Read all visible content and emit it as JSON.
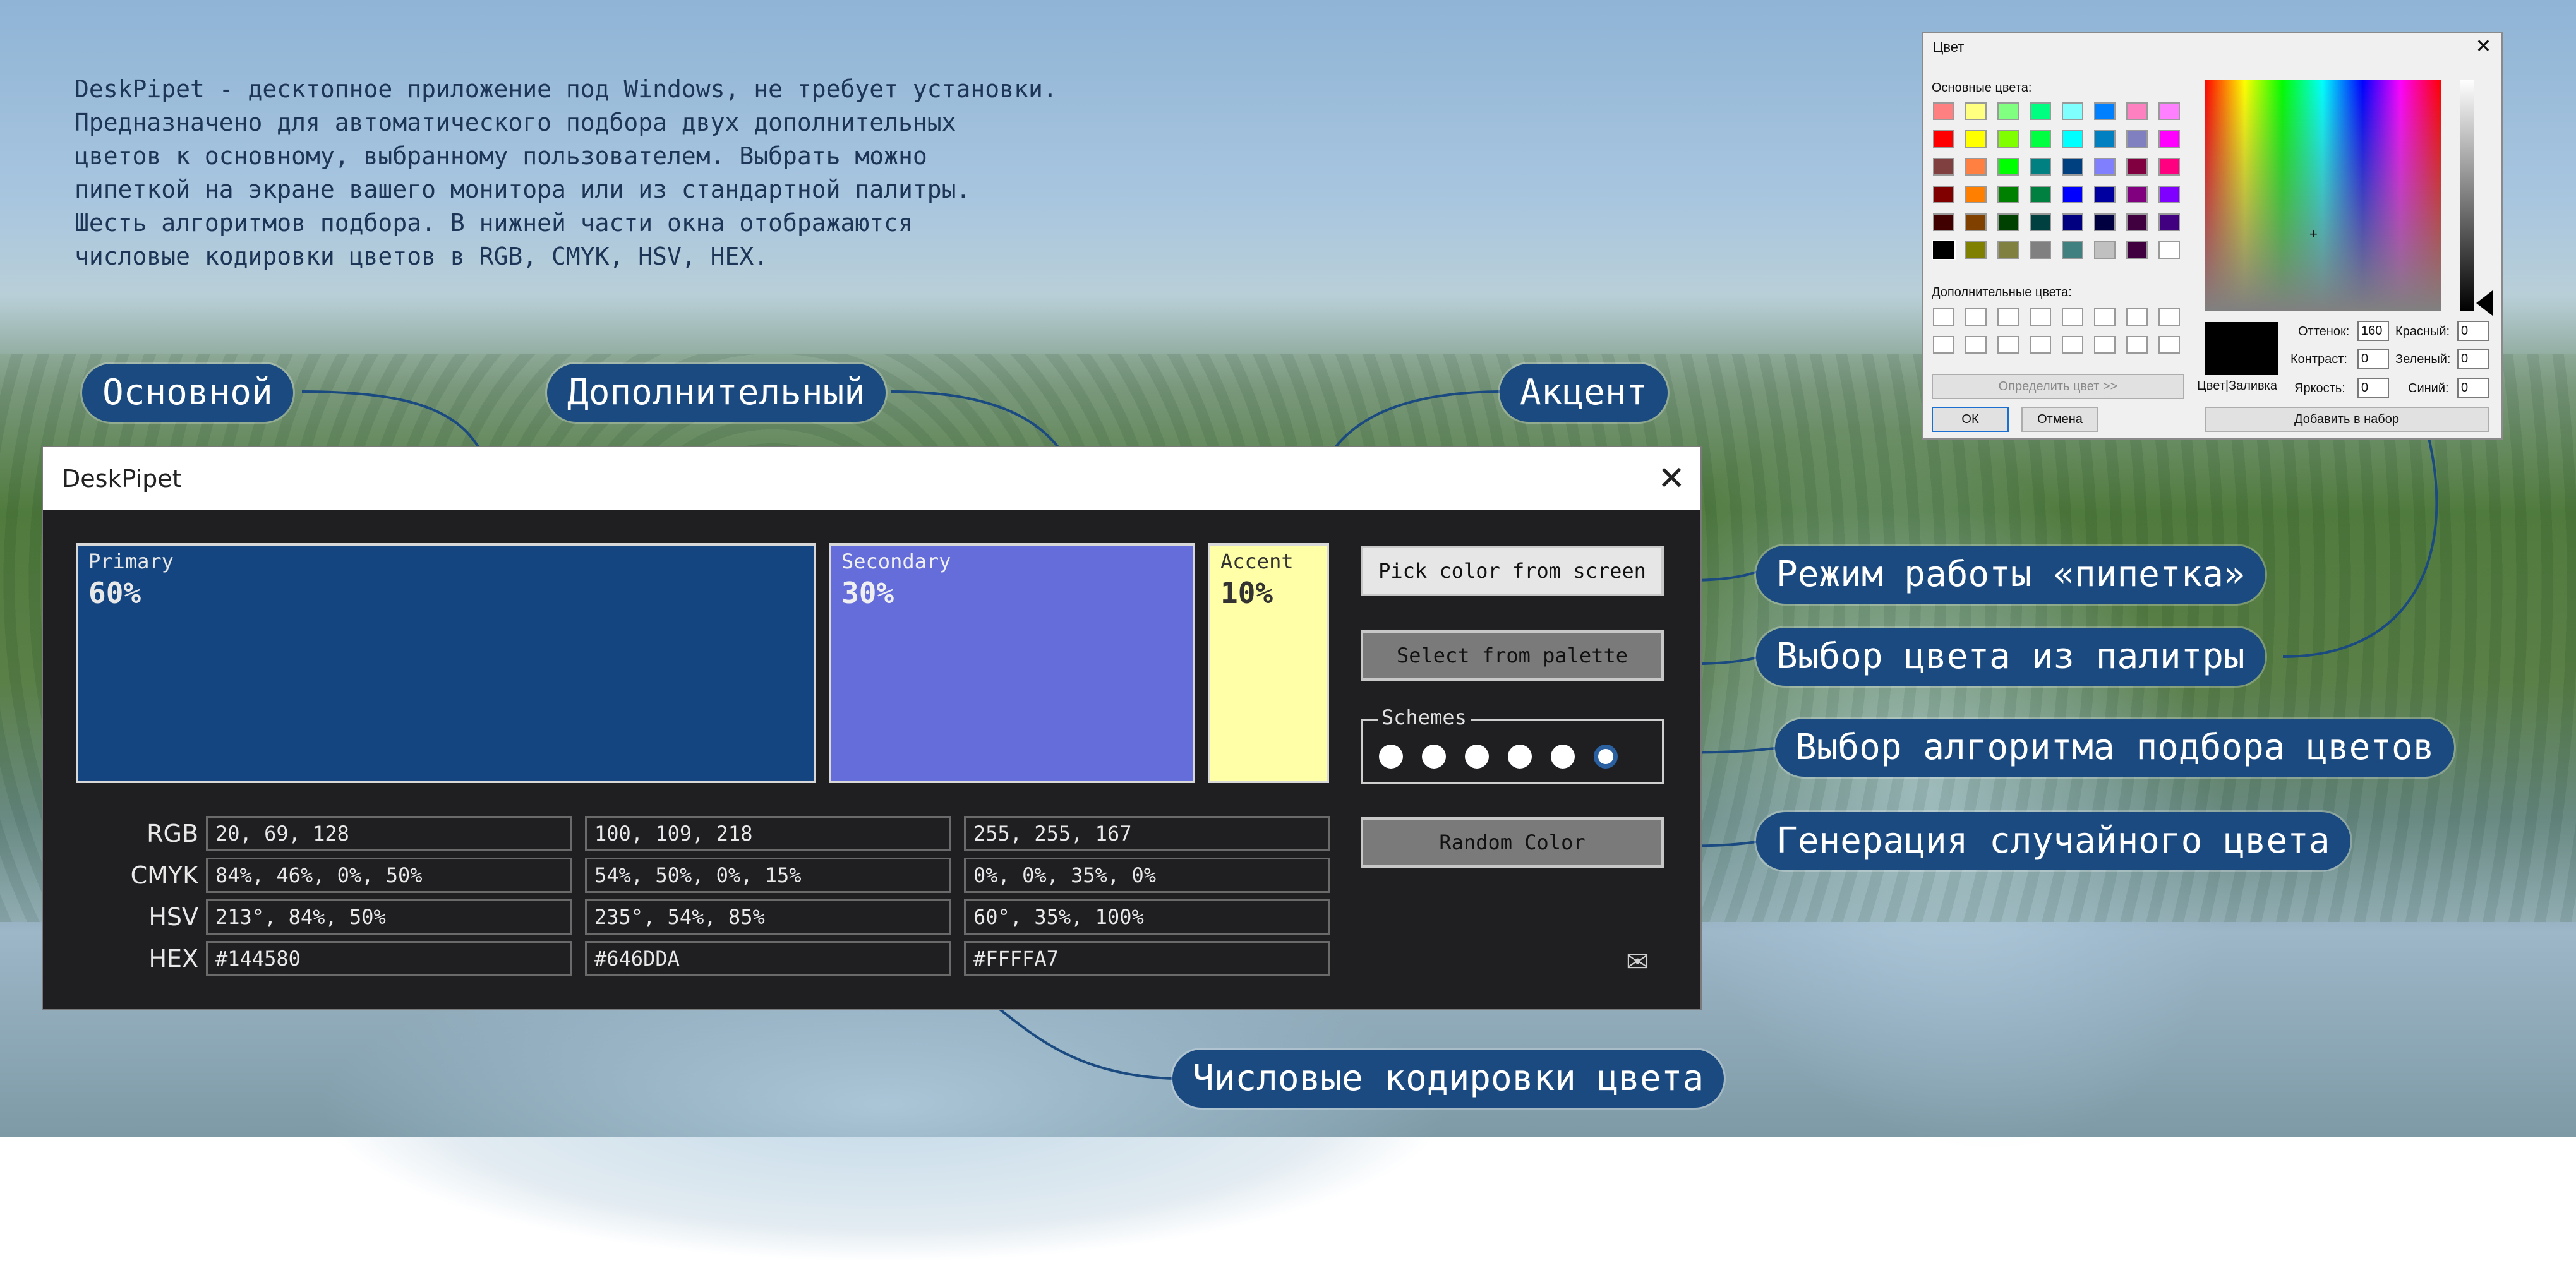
{
  "description": [
    "DeskPipet - десктопное приложение под Windows, не требует установки.",
    "Предназначено для автоматического подбора двух дополнительных",
    "цветов к основному, выбранному пользователем. Выбрать можно",
    "пипеткой на экране вашего монитора или из стандартной палитры.",
    "Шесть алгоритмов подбора. В нижней части окна отображаются",
    "числовые кодировки цветов в RGB, CMYK, HSV, HEX."
  ],
  "callouts": {
    "primary": "Основной",
    "secondary": "Дополнительный",
    "accent": "Акцент",
    "pipette": "Режим работы «пипетка»",
    "palette": "Выбор цвета из палитры",
    "algorithm": "Выбор алгоритма подбора цветов",
    "random": "Генерация случайного цвета",
    "codes": "Числовые кодировки цвета"
  },
  "window": {
    "title": "DeskPipet",
    "close": "✕",
    "swatches": {
      "primary": {
        "label": "Primary",
        "percent": "60%",
        "color": "#144580"
      },
      "secondary": {
        "label": "Secondary",
        "percent": "30%",
        "color": "#646DDA"
      },
      "accent": {
        "label": "Accent",
        "percent": "10%",
        "color": "#FFFFA7"
      }
    },
    "buttons": {
      "pick": "Pick color from screen",
      "palette": "Select from palette",
      "random": "Random Color"
    },
    "schemes": {
      "legend": "Schemes",
      "count": 6,
      "selected_index": 5
    },
    "rows": [
      {
        "label": "RGB",
        "arrow": "→",
        "values": [
          "20, 69, 128",
          "100, 109, 218",
          "255, 255, 167"
        ]
      },
      {
        "label": "CMYK",
        "arrow": "→",
        "values": [
          "84%, 46%, 0%, 50%",
          "54%, 50%, 0%, 15%",
          "0%, 0%, 35%, 0%"
        ]
      },
      {
        "label": "HSV",
        "arrow": "→",
        "values": [
          "213°, 84%, 50%",
          "235°, 54%, 85%",
          "60°, 35%, 100%"
        ]
      },
      {
        "label": "HEX",
        "arrow": "→",
        "values": [
          "#144580",
          "#646DDA",
          "#FFFFA7"
        ]
      }
    ],
    "mail_icon": "envelope-icon"
  },
  "color_dialog": {
    "title": "Цвет",
    "close": "✕",
    "basic_colors_label": "Основные цвета:",
    "custom_colors_label": "Дополнительные цвета:",
    "define_button": "Определить цвет >>",
    "ok": "ОК",
    "cancel": "Отмена",
    "add_button": "Добавить в набор",
    "preview_label": "Цвет|Заливка",
    "fields": {
      "hue": {
        "label": "Оттенок:",
        "value": "160"
      },
      "sat": {
        "label": "Контраст:",
        "value": "0"
      },
      "lum": {
        "label": "Яркость:",
        "value": "0"
      },
      "red": {
        "label": "Красный:",
        "value": "0"
      },
      "green": {
        "label": "Зеленый:",
        "value": "0"
      },
      "blue": {
        "label": "Синий:",
        "value": "0"
      }
    },
    "basic_colors": [
      [
        "#FF8080",
        "#FFFF80",
        "#80FF80",
        "#00FF80",
        "#80FFFF",
        "#0080FF",
        "#FF80C0",
        "#FF80FF"
      ],
      [
        "#FF0000",
        "#FFFF00",
        "#80FF00",
        "#00FF40",
        "#00FFFF",
        "#0080C0",
        "#8080C0",
        "#FF00FF"
      ],
      [
        "#804040",
        "#FF8040",
        "#00FF00",
        "#008080",
        "#004080",
        "#8080FF",
        "#800040",
        "#FF0080"
      ],
      [
        "#800000",
        "#FF8000",
        "#008000",
        "#008040",
        "#0000FF",
        "#0000A0",
        "#800080",
        "#8000FF"
      ],
      [
        "#400000",
        "#804000",
        "#004000",
        "#004040",
        "#000080",
        "#000040",
        "#400040",
        "#400080"
      ],
      [
        "#000000",
        "#808000",
        "#808040",
        "#808080",
        "#408080",
        "#C0C0C0",
        "#400040",
        "#FFFFFF"
      ]
    ]
  }
}
